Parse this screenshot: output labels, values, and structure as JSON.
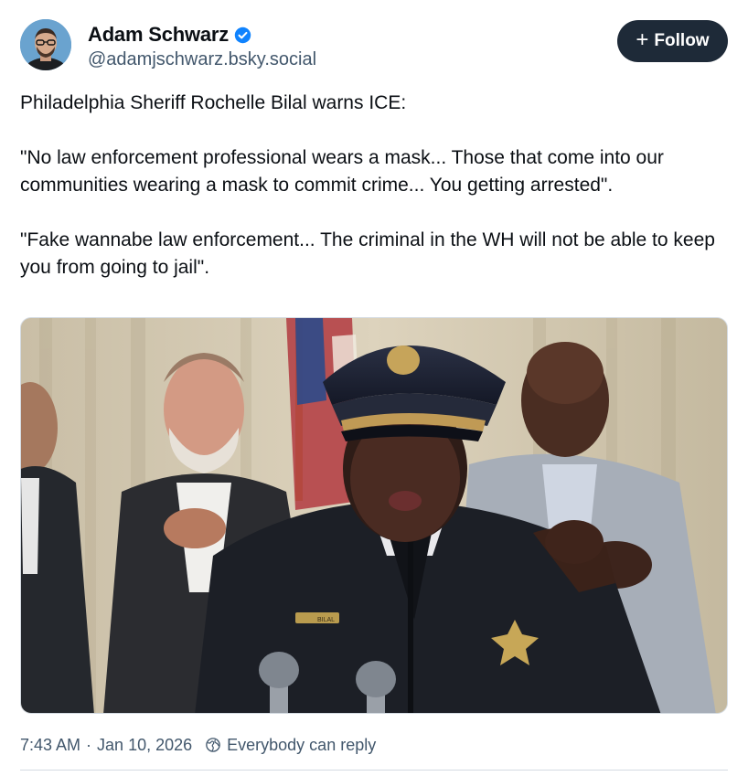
{
  "author": {
    "name": "Adam Schwarz",
    "handle": "@adamjschwarz.bsky.social",
    "verified": true
  },
  "follow_button": {
    "plus": "+",
    "label": "Follow"
  },
  "post": {
    "paragraphs": [
      "Philadelphia Sheriff Rochelle Bilal warns ICE:",
      "\"No law enforcement professional wears a mask... Those that come into our communities wearing a mask to commit crime... You getting arrested\".",
      "\"Fake wannabe law enforcement... The criminal in the WH will not be able to keep you from going to jail\"."
    ]
  },
  "media": {
    "uniform_nameplate": "BILAL"
  },
  "meta": {
    "time": "7:43 AM",
    "separator": "·",
    "date": "Jan 10, 2026",
    "reply_setting": "Everybody can reply"
  },
  "colors": {
    "accent": "#1083fe",
    "follow_bg": "#1e2a38",
    "muted_text": "#42576c"
  }
}
